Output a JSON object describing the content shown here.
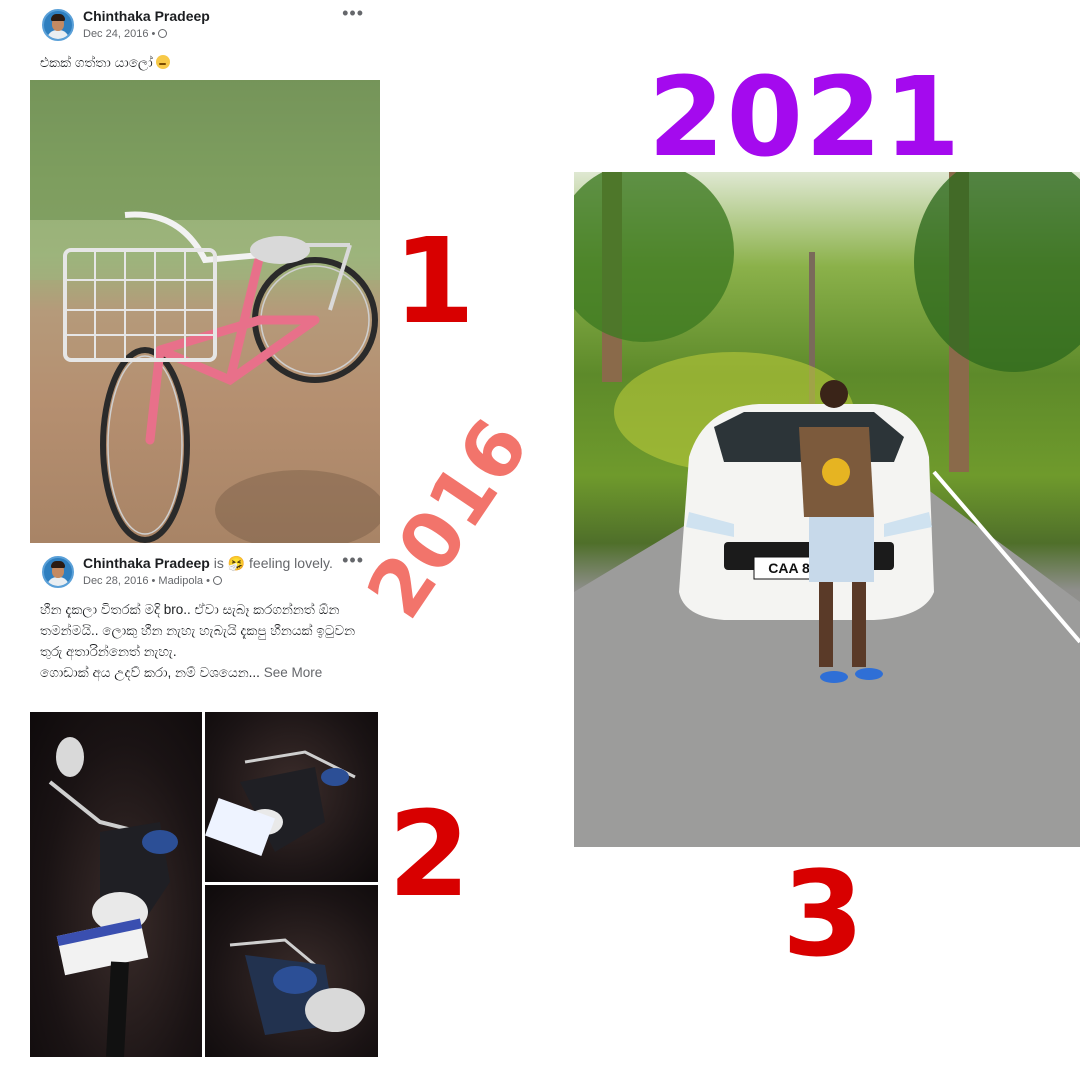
{
  "post1": {
    "author": "Chinthaka Pradeep",
    "date": "Dec 24, 2016 •",
    "text": "එකක් ගත්තා යාලෝ"
  },
  "post2": {
    "author": "Chinthaka Pradeep",
    "activity": " is 🤧 feeling lovely.",
    "date": "Dec 28, 2016 • Madipola •",
    "text": "හීන දැකලා විතරක් මදි bro.. ඒවා සැබෑ කරගන්නත් ඕන තමන්මයි.. ලොකු හීන නැහැ හැබැයි දැකපු හීනයක් ඉටුවන තුරු අතාරින්නෙත් නැහැ.",
    "text2": "ගොඩාක් අය උදව් කරා, නම් වශයෙන...",
    "see_more": "See More"
  },
  "labels": {
    "one": "1",
    "two": "2",
    "three": "3",
    "year_old": "2016",
    "year_new": "2021"
  },
  "colors": {
    "number_red": "#d80000",
    "year_2021_purple": "#a40aee",
    "year_2016_salmon": "#f2746b"
  },
  "photo_text": {
    "plate": "CAA 8"
  }
}
